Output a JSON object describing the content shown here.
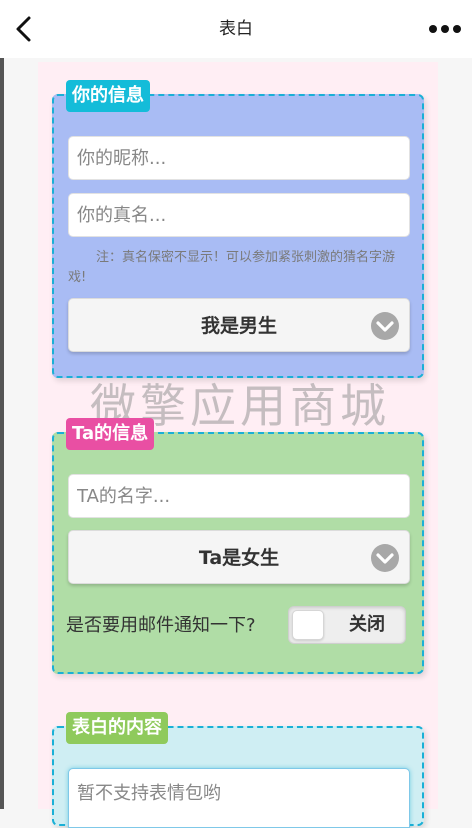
{
  "navbar": {
    "title": "表白",
    "back_icon": "chevron-left-icon",
    "more_icon": "more-dots-icon"
  },
  "colors": {
    "page_bg": "#ffeef4",
    "card_you_bg": "#a9bcf4",
    "card_ta_bg": "#b0dda6",
    "card_content_bg": "#cfeef3",
    "card_border": "#1ab0d6",
    "label_you": "#14bcd9",
    "label_ta": "#e94fa3",
    "label_content": "#8fca5c"
  },
  "you_section": {
    "label": "你的信息",
    "nickname_placeholder": "你的昵称...",
    "realname_placeholder": "你的真名...",
    "note": "注：真名保密不显示！可以参加紧张刺激的猜名字游戏!",
    "gender_select": {
      "selected": "我是男生",
      "icon": "chevron-down-circle-icon"
    }
  },
  "ta_section": {
    "label": "Ta的信息",
    "name_placeholder": "TA的名字...",
    "gender_select": {
      "selected": "Ta是女生",
      "icon": "chevron-down-circle-icon"
    },
    "notify_label": "是否要用邮件通知一下?",
    "notify_toggle": {
      "state_text": "关闭",
      "on": false
    }
  },
  "content_section": {
    "label": "表白的内容",
    "textarea_placeholder": "暂不支持表情包哟"
  },
  "watermark": "微擎应用商城"
}
